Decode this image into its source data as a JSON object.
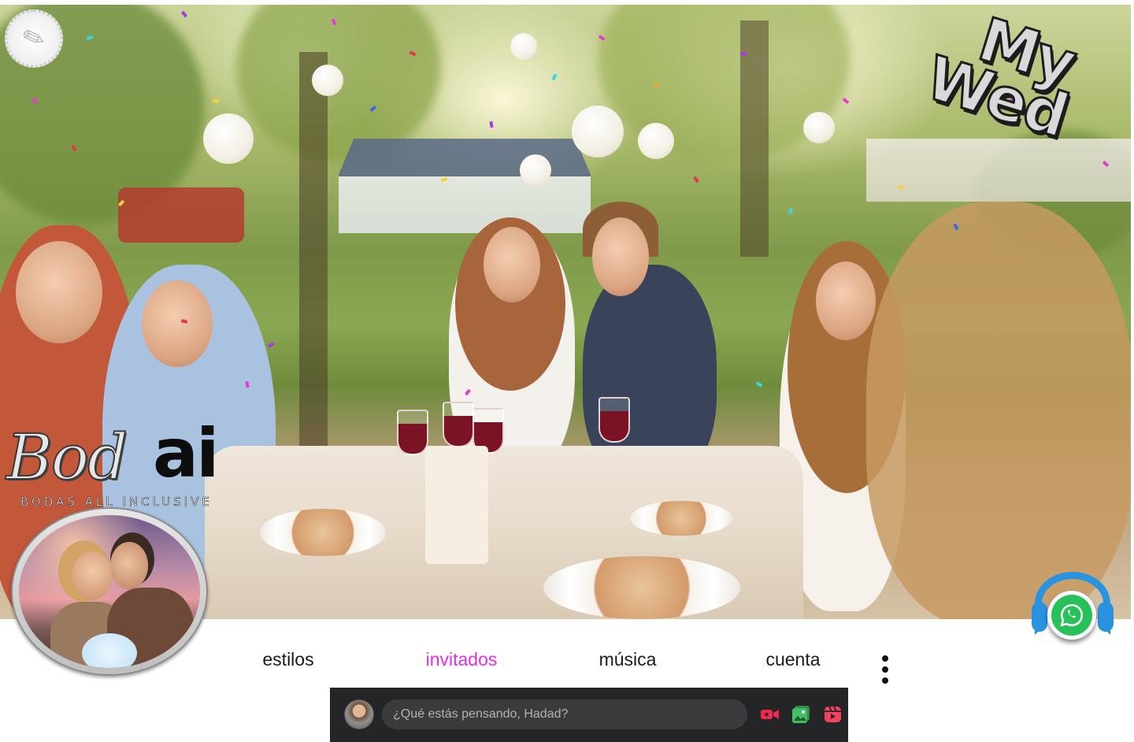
{
  "branding": {
    "mywed_logo": {
      "line1": "My",
      "line2": "Wed"
    },
    "bodai_logo": {
      "word_part": "Bod",
      "ai_part": "ai",
      "tagline": "BODAS ALL INCLUSIVE"
    }
  },
  "nav": {
    "items": [
      {
        "label": "estilos",
        "active": false
      },
      {
        "label": "invitados",
        "active": true
      },
      {
        "label": "música",
        "active": false
      },
      {
        "label": "cuenta",
        "active": false
      }
    ],
    "more_icon": "vertical-ellipsis-icon",
    "active_color": "#e62ee6"
  },
  "composer": {
    "placeholder": "¿Qué estás pensando, Hadad?",
    "actions": [
      {
        "icon": "live-video-icon",
        "color": "#f02849"
      },
      {
        "icon": "photo-video-icon",
        "color": "#45bd62"
      },
      {
        "icon": "reel-icon",
        "color": "#f3425f"
      }
    ]
  },
  "whatsapp": {
    "icon": "whatsapp-headphones-icon",
    "color": "#27c15a"
  }
}
